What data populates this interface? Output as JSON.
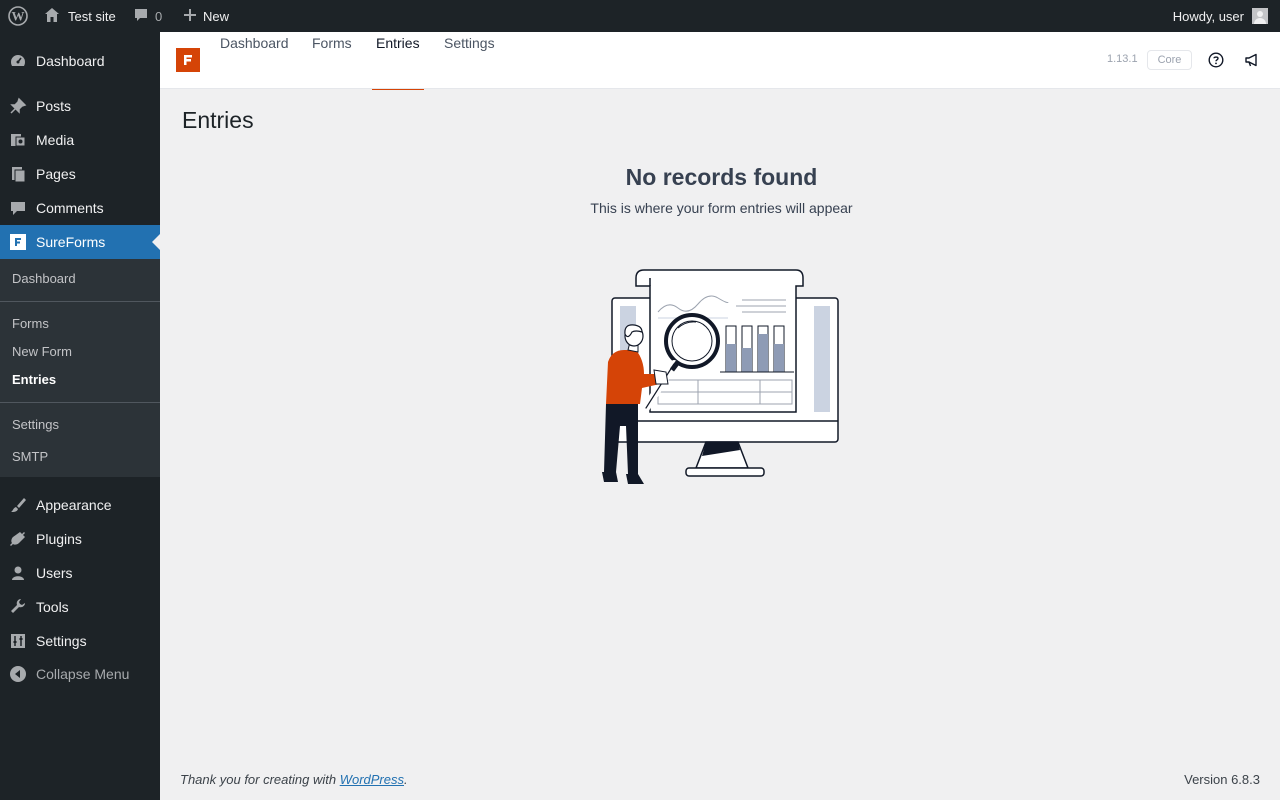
{
  "adminbar": {
    "site_name": "Test site",
    "comments_count": "0",
    "new_label": "New",
    "howdy": "Howdy, user"
  },
  "sidebar": {
    "items": [
      {
        "label": "Dashboard",
        "icon": "dashboard-icon"
      },
      {
        "label": "Posts",
        "icon": "pushpin-icon"
      },
      {
        "label": "Media",
        "icon": "media-icon"
      },
      {
        "label": "Pages",
        "icon": "pages-icon"
      },
      {
        "label": "Comments",
        "icon": "comment-icon"
      },
      {
        "label": "SureForms",
        "icon": "sureforms-icon"
      },
      {
        "label": "Appearance",
        "icon": "paintbrush-icon"
      },
      {
        "label": "Plugins",
        "icon": "plugin-icon"
      },
      {
        "label": "Users",
        "icon": "users-icon"
      },
      {
        "label": "Tools",
        "icon": "wrench-icon"
      },
      {
        "label": "Settings",
        "icon": "settings-icon"
      },
      {
        "label": "Collapse Menu",
        "icon": "collapse-icon"
      }
    ],
    "submenu": [
      "Dashboard",
      "Forms",
      "New Form",
      "Entries",
      "Settings",
      "SMTP"
    ]
  },
  "plugin_header": {
    "tabs": [
      "Dashboard",
      "Forms",
      "Entries",
      "Settings"
    ],
    "active_tab": "Entries",
    "version": "1.13.1",
    "badge": "Core"
  },
  "main": {
    "title": "Entries",
    "empty_title": "No records found",
    "empty_subtitle": "This is where your form entries will appear"
  },
  "footer": {
    "thanks_prefix": "Thank you for creating with ",
    "thanks_link": "WordPress",
    "thanks_suffix": ".",
    "version": "Version 6.8.3"
  },
  "colors": {
    "accent": "#d54407",
    "wp_blue": "#2271b1",
    "admin_dark": "#1d2327"
  }
}
